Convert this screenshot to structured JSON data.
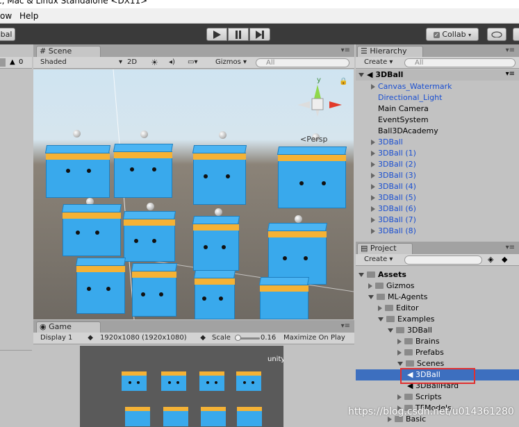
{
  "window": {
    "title_fragment": "c, Mac & Linux Standalone <DX11>"
  },
  "menu": {
    "items": [
      "ow",
      "Help"
    ]
  },
  "toolbar": {
    "left_label": "bal",
    "collab_label": "Collab",
    "play_icons": [
      "play-icon",
      "pause-icon",
      "step-icon"
    ]
  },
  "left_panel": {
    "count": "0"
  },
  "scene": {
    "tab_label": "Scene",
    "shading": "Shaded",
    "mode_2d": "2D",
    "gizmos": "Gizmos",
    "search_placeholder": "All",
    "persp_label": "<Persp",
    "gizmo_axes": {
      "y": "y"
    }
  },
  "game": {
    "tab_label": "Game",
    "display": "Display 1",
    "resolution": "1920x1080 (1920x1080)",
    "scale_label": "Scale",
    "scale_value": "0.16",
    "maximize": "Maximize On Play",
    "watermark": "unity"
  },
  "hierarchy": {
    "tab_label": "Hierarchy",
    "create_label": "Create",
    "search_placeholder": "All",
    "scene_name": "3DBall",
    "items": [
      {
        "label": "Canvas_Watermark",
        "prefab": true,
        "expandable": true
      },
      {
        "label": "Directional_Light",
        "prefab": true,
        "expandable": false
      },
      {
        "label": "Main Camera",
        "prefab": false,
        "expandable": false
      },
      {
        "label": "EventSystem",
        "prefab": false,
        "expandable": false
      },
      {
        "label": "Ball3DAcademy",
        "prefab": false,
        "expandable": false
      },
      {
        "label": "3DBall",
        "prefab": true,
        "expandable": true
      },
      {
        "label": "3DBall (1)",
        "prefab": true,
        "expandable": true
      },
      {
        "label": "3DBall (2)",
        "prefab": true,
        "expandable": true
      },
      {
        "label": "3DBall (3)",
        "prefab": true,
        "expandable": true
      },
      {
        "label": "3DBall (4)",
        "prefab": true,
        "expandable": true
      },
      {
        "label": "3DBall (5)",
        "prefab": true,
        "expandable": true
      },
      {
        "label": "3DBall (6)",
        "prefab": true,
        "expandable": true
      },
      {
        "label": "3DBall (7)",
        "prefab": true,
        "expandable": true
      },
      {
        "label": "3DBall (8)",
        "prefab": true,
        "expandable": true
      }
    ]
  },
  "project": {
    "tab_label": "Project",
    "create_label": "Create",
    "tree": [
      {
        "label": "Assets",
        "level": 0,
        "open": true,
        "bold": true
      },
      {
        "label": "Gizmos",
        "level": 1,
        "open": false
      },
      {
        "label": "ML-Agents",
        "level": 1,
        "open": true
      },
      {
        "label": "Editor",
        "level": 2,
        "open": false
      },
      {
        "label": "Examples",
        "level": 2,
        "open": true
      },
      {
        "label": "3DBall",
        "level": 3,
        "open": true
      },
      {
        "label": "Brains",
        "level": 4,
        "open": false
      },
      {
        "label": "Prefabs",
        "level": 4,
        "open": false
      },
      {
        "label": "Scenes",
        "level": 4,
        "open": true
      },
      {
        "label": "3DBall",
        "level": 5,
        "open": false,
        "selected": true,
        "scene": true
      },
      {
        "label": "3DBallHard",
        "level": 5,
        "open": false,
        "scene": true
      },
      {
        "label": "Scripts",
        "level": 4,
        "open": false
      },
      {
        "label": "TFModels",
        "level": 4,
        "open": false
      },
      {
        "label": "Basic",
        "level": 3,
        "open": false
      }
    ]
  },
  "watermark": "https://blog.csdn.net/u014361280",
  "colors": {
    "prefab_blue": "#1a4fd1",
    "selection": "#3d6fbf",
    "highlight_box": "#e03030",
    "cube_blue": "#39a9ec",
    "cube_band": "#f5b235"
  }
}
